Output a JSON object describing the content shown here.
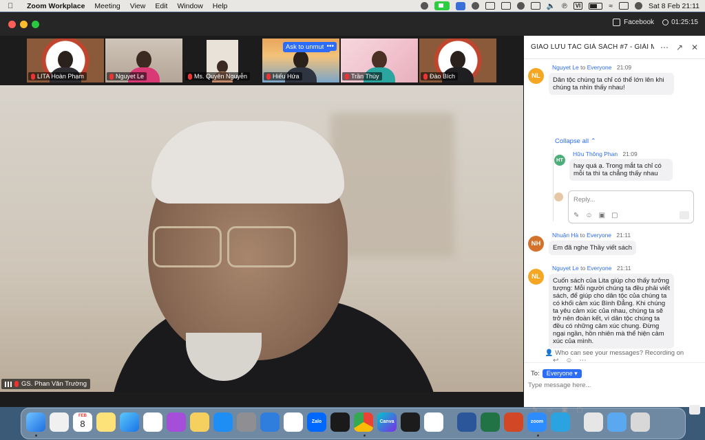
{
  "menubar": {
    "app": "Zoom Workplace",
    "items": [
      "Meeting",
      "View",
      "Edit",
      "Window",
      "Help"
    ],
    "input_source": "VI",
    "datetime": "Sat 8 Feb  21:11"
  },
  "titlebar": {
    "facebook_label": "Facebook",
    "timer": "01:25:15"
  },
  "thumbnails": [
    {
      "name": "LITA Hoàn Phạm"
    },
    {
      "name": "Nguyet Le"
    },
    {
      "name": "Ms. Quyên Nguyễn"
    },
    {
      "name": "Hiếu Hứa"
    },
    {
      "name": "Trần Thùy"
    },
    {
      "name": "Đào Bích"
    }
  ],
  "ask_to_unmute": "Ask to unmute",
  "more_label": "•••",
  "speaker": {
    "name": "GS. Phan Văn Trường"
  },
  "chat": {
    "title": "GIAO LƯU TÁC GIẢ SÁCH #7 - GIẢI MÃ...",
    "to_word": "to",
    "messages": [
      {
        "initials": "NL",
        "sender": "Nguyet Le",
        "recipient": "Everyone",
        "time": "21:09",
        "color": "#f5a623",
        "text": "Dân tộc chúng ta chỉ có thể lớn lên khi chúng ta nhìn thấy nhau!"
      },
      {
        "initials": "NH",
        "sender": "Nhuận Hà",
        "recipient": "Everyone",
        "time": "21:11",
        "color": "#d4712a",
        "text": "Em đã nghe Thầy viết sách"
      },
      {
        "initials": "NL",
        "sender": "Nguyet Le",
        "recipient": "Everyone",
        "time": "21:11",
        "color": "#f5a623",
        "text": "Cuốn sách của Lita giúp cho thấy tưởng tượng: Mỗi người chúng ta đều phải viết sách, để giúp cho dân tộc của chúng ta có khối cảm xúc Bình Đẳng. Khi chúng ta yêu cảm xúc của nhau, chúng ta sẽ trở nên đoàn kết, vì dân tộc chúng ta đều có những cảm xúc chung. Đừng ngại ngần, hồn nhiên mà thể hiện cảm xúc của mình."
      }
    ],
    "collapse_label": "Collapse all",
    "reply": {
      "initials": "HT",
      "sender": "Hữu Thông Phan",
      "time": "21:09",
      "color": "#4caf7a",
      "text": "hay quá ạ. Trong mắt ta chỉ có mỗi ta thì ta chẳng thấy nhau"
    },
    "reply_placeholder": "Reply...",
    "who_can_see": "Who can see your messages? Recording on",
    "to_label": "To:",
    "to_value": "Everyone",
    "input_placeholder": "Type message here..."
  },
  "dock_calendar": {
    "month": "FEB",
    "day": "8"
  },
  "dock_labels": {
    "zalo": "Zalo",
    "canva": "Canva",
    "zoom": "zoom"
  }
}
